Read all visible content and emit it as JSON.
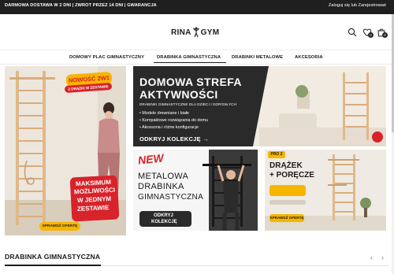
{
  "topbar": {
    "promo": "DARMOWA DOSTAWA W 2 DNI | ZWROT PRZEZ 14 DNI | GWARANCJA",
    "login": "Zaloguj się lub Zarejestrowaé"
  },
  "header": {
    "logo_left": "RINA",
    "logo_right": "GYM",
    "wishlist_count": "0",
    "cart_count": "0"
  },
  "nav": {
    "items": [
      {
        "label": "DOMOWY PLAC GIMNASTYCZNY"
      },
      {
        "label": "DRABINKA GIMNASTYCZNA"
      },
      {
        "label": "DRABINKI METALOWE"
      },
      {
        "label": "AKCESORIA"
      }
    ]
  },
  "banner1": {
    "badge_title": "NOWOŚĆ 2W1",
    "badge_sub": "2 DRĄŻKI W ZESTAWIE",
    "promo_line1": "MAKSIMUM",
    "promo_line2": "MOŻLIWOŚCI",
    "promo_line3": "W JEDNYM",
    "promo_line4": "ZESTAWIE",
    "cta": "SPRAWDŹ OFERTĘ"
  },
  "banner2": {
    "title_line1": "DOMOWA STREFA",
    "title_line2": "AKTYWNOŚCI",
    "subtitle": "DRABINKI GIMNASTYCZNE DLA DZIECI I DOROSŁYCH",
    "bullets": [
      "Modele drewniane i białe",
      "Kompaktowe rozwiązania do domu",
      "Akcesoria i różne konfiguracje"
    ],
    "cta": "ODKRYJ KOLEKCJĘ →"
  },
  "banner3": {
    "tag": "NEW",
    "line1": "METALOWA",
    "line2": "DRABINKA",
    "line3": "GIMNASTYCZNA",
    "cta_line1": "ODKRYJ",
    "cta_line2": "KOLEKCJĘ"
  },
  "banner4": {
    "tag": "PRO 2",
    "line1": "DRĄŻEK",
    "line2": "+ PORĘCZE",
    "cta": "SPRAWDŹ OFERTĘ"
  },
  "section": {
    "title": "DRABINKA GIMNASTYCZNA",
    "prev": "‹",
    "next": "›"
  },
  "colors": {
    "accent_yellow": "#f7b500",
    "accent_red": "#d8232a",
    "dark": "#1f1f1f"
  }
}
